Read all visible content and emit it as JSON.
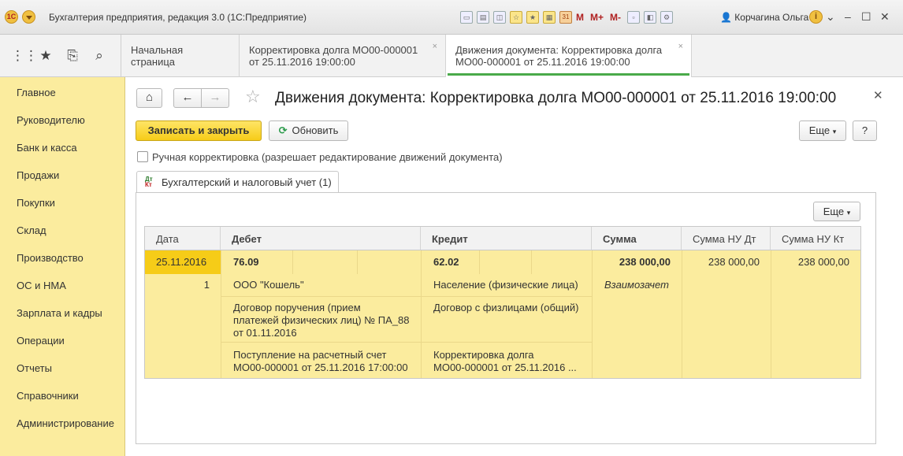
{
  "window": {
    "title": "Бухгалтерия предприятия, редакция 3.0  (1С:Предприятие)",
    "toolbar_letters": [
      "M",
      "M+",
      "M-"
    ],
    "user": "Корчагина Ольга",
    "calendar_day": "31"
  },
  "tabs": [
    {
      "label": "Начальная страница"
    },
    {
      "line1": "Корректировка долга МО00-000001",
      "line2": "от 25.11.2016 19:00:00"
    },
    {
      "line1": "Движения документа: Корректировка долга",
      "line2": "МО00-000001 от 25.11.2016 19:00:00"
    }
  ],
  "sidebar": {
    "items": [
      "Главное",
      "Руководителю",
      "Банк и касса",
      "Продажи",
      "Покупки",
      "Склад",
      "Производство",
      "ОС и НМА",
      "Зарплата и кадры",
      "Операции",
      "Отчеты",
      "Справочники",
      "Администрирование"
    ]
  },
  "form": {
    "title": "Движения документа: Корректировка долга МО00-000001 от 25.11.2016 19:00:00",
    "save_label": "Записать и закрыть",
    "refresh_label": "Обновить",
    "more_label": "Еще",
    "help_label": "?",
    "manual_label": "Ручная корректировка (разрешает редактирование движений документа)",
    "subtab_label": "Бухгалтерский и налоговый учет (1)",
    "subtab_icon_top": "Дт",
    "subtab_icon_bottom": "Кт",
    "panel_more_label": "Еще"
  },
  "table": {
    "columns": [
      "Дата",
      "Дебет",
      "Кредит",
      "Сумма",
      "Сумма НУ Дт",
      "Сумма НУ Кт"
    ],
    "row": {
      "date": "25.11.2016",
      "number": "1",
      "debit_account": "76.09",
      "credit_account": "62.02",
      "sum": "238 000,00",
      "sum_nu_dt": "238 000,00",
      "sum_nu_kt": "238 000,00",
      "content": "Взаимозачет",
      "debit_sub1": "ООО \"Кошель\"",
      "debit_sub2_l1": "Договор поручения (прием",
      "debit_sub2_l2": "платежей физических лиц) № ПА_88",
      "debit_sub2_l3": "от 01.11.2016",
      "debit_sub3_l1": "Поступление на расчетный счет",
      "debit_sub3_l2": "МО00-000001 от 25.11.2016 17:00:00",
      "credit_sub1": "Население (физические лица)",
      "credit_sub2": "Договор с физлицами (общий)",
      "credit_sub3_l1": "Корректировка долга",
      "credit_sub3_l2": "МО00-000001 от 25.11.2016 ..."
    }
  }
}
